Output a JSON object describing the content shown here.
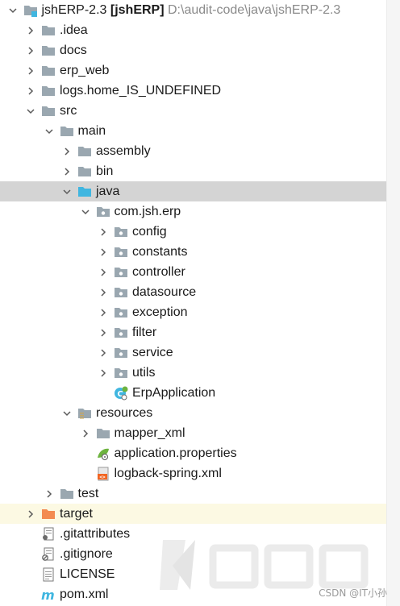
{
  "project_tree": {
    "items": [
      {
        "label": "jshERP-2.3",
        "suffix": "[jshERP]",
        "path": "D:\\audit-code\\java\\jshERP-2.3",
        "level": 0,
        "expanded": true,
        "icon": "module-folder-icon"
      },
      {
        "label": ".idea",
        "level": 1,
        "expanded": false,
        "icon": "folder-icon"
      },
      {
        "label": "docs",
        "level": 1,
        "expanded": false,
        "icon": "folder-icon"
      },
      {
        "label": "erp_web",
        "level": 1,
        "expanded": false,
        "icon": "folder-icon"
      },
      {
        "label": "logs.home_IS_UNDEFINED",
        "level": 1,
        "expanded": false,
        "icon": "folder-icon"
      },
      {
        "label": "src",
        "level": 1,
        "expanded": true,
        "icon": "folder-icon"
      },
      {
        "label": "main",
        "level": 2,
        "expanded": true,
        "icon": "folder-icon"
      },
      {
        "label": "assembly",
        "level": 3,
        "expanded": false,
        "icon": "folder-icon"
      },
      {
        "label": "bin",
        "level": 3,
        "expanded": false,
        "icon": "folder-icon"
      },
      {
        "label": "java",
        "level": 3,
        "expanded": true,
        "icon": "source-folder-icon",
        "selected": true
      },
      {
        "label": "com.jsh.erp",
        "level": 4,
        "expanded": true,
        "icon": "package-icon"
      },
      {
        "label": "config",
        "level": 5,
        "expanded": false,
        "icon": "package-icon"
      },
      {
        "label": "constants",
        "level": 5,
        "expanded": false,
        "icon": "package-icon"
      },
      {
        "label": "controller",
        "level": 5,
        "expanded": false,
        "icon": "package-icon"
      },
      {
        "label": "datasource",
        "level": 5,
        "expanded": false,
        "icon": "package-icon"
      },
      {
        "label": "exception",
        "level": 5,
        "expanded": false,
        "icon": "package-icon"
      },
      {
        "label": "filter",
        "level": 5,
        "expanded": false,
        "icon": "package-icon"
      },
      {
        "label": "service",
        "level": 5,
        "expanded": false,
        "icon": "package-icon"
      },
      {
        "label": "utils",
        "level": 5,
        "expanded": false,
        "icon": "package-icon"
      },
      {
        "label": "ErpApplication",
        "level": 5,
        "leaf": true,
        "icon": "spring-boot-class-icon"
      },
      {
        "label": "resources",
        "level": 3,
        "expanded": true,
        "icon": "resources-folder-icon"
      },
      {
        "label": "mapper_xml",
        "level": 4,
        "expanded": false,
        "icon": "folder-icon"
      },
      {
        "label": "application.properties",
        "level": 4,
        "leaf": true,
        "icon": "spring-properties-icon"
      },
      {
        "label": "logback-spring.xml",
        "level": 4,
        "leaf": true,
        "icon": "xml-file-icon"
      },
      {
        "label": "test",
        "level": 2,
        "expanded": false,
        "icon": "folder-icon"
      },
      {
        "label": "target",
        "level": 1,
        "expanded": false,
        "icon": "excluded-folder-icon",
        "excluded": true
      },
      {
        "label": ".gitattributes",
        "level": 1,
        "leaf": true,
        "icon": "git-file-icon"
      },
      {
        "label": ".gitignore",
        "level": 1,
        "leaf": true,
        "icon": "gitignore-file-icon"
      },
      {
        "label": "LICENSE",
        "level": 1,
        "leaf": true,
        "icon": "text-file-icon"
      },
      {
        "label": "pom.xml",
        "level": 1,
        "leaf": true,
        "icon": "maven-icon"
      }
    ]
  },
  "colors": {
    "folder": "#9aa7b0",
    "source_folder": "#40b6e0",
    "excluded_folder": "#f38b52",
    "selection": "#d4d4d4",
    "excluded_row": "#fcf9e3"
  },
  "watermark": {
    "text": "CSDN @IT小孙"
  }
}
